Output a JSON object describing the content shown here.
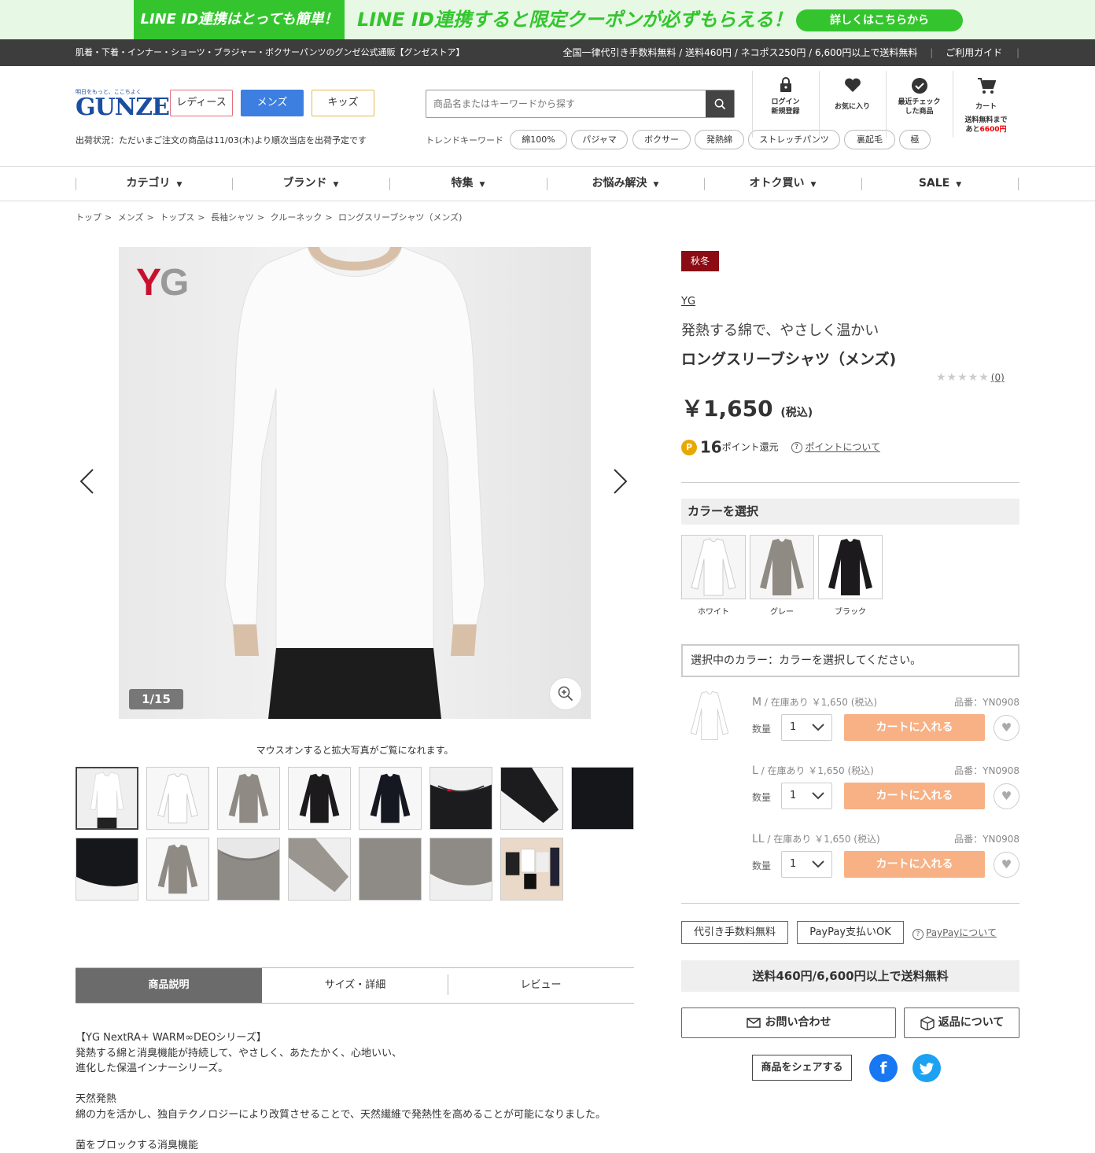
{
  "banner": {
    "left": "LINE ID連携はとっても簡単！",
    "middle": "LINE ID連携すると限定クーポンが必ずもらえる！",
    "button": "詳しくはこちらから"
  },
  "topbar": {
    "left": "肌着・下着・インナー・ショーツ・ブラジャー・ボクサーパンツのグンゼ公式通販【グンゼストア】",
    "shipping": "全国一律代引き手数料無料 / 送料460円 / ネコポス250円 / 6,600円以上で送料無料",
    "guide": "ご利用ガイド"
  },
  "logo": {
    "tagline": "明日をもっと、ここちよく",
    "word": "GUNZE"
  },
  "gender": [
    "レディース",
    "メンズ",
    "キッズ"
  ],
  "status": "出荷状況：ただいまご注文の商品は11/03(木)より順次当店を出荷予定です",
  "search": {
    "placeholder": "商品名またはキーワードから探す"
  },
  "trend": {
    "label": "トレンドキーワード",
    "chips": [
      "綿100%",
      "パジャマ",
      "ボクサー",
      "発熱綿",
      "ストレッチパンツ",
      "裏起毛",
      "極"
    ]
  },
  "header_icons": {
    "login": {
      "line1": "ログイン",
      "line2": "新規登録"
    },
    "fav": {
      "line1": "お気に入り"
    },
    "recent": {
      "line1": "最近チェック",
      "line2": "した商品"
    },
    "cart": {
      "line1": "カート",
      "line2": "送料無料まで",
      "line3a": "あと",
      "line3b": "6600円"
    }
  },
  "nav": [
    "カテゴリ",
    "ブランド",
    "特集",
    "お悩み解決",
    "オトク買い",
    "SALE"
  ],
  "breadcrumb": [
    "トップ",
    "メンズ",
    "トップス",
    "長袖シャツ",
    "クルーネック",
    "ロングスリーブシャツ（メンズ)"
  ],
  "gallery": {
    "logo_y": "Y",
    "logo_g": "G",
    "counter": "1/15",
    "note": "マウスオンすると拡大写真がご覧になれます。"
  },
  "tabs": [
    "商品説明",
    "サイズ・詳細",
    "レビュー"
  ],
  "description": [
    "【YG NextRA+ WARM∞DEOシリーズ】",
    "発熱する綿と消臭機能が持続して、やさしく、あたたかく、心地いい、",
    "進化した保温インナーシリーズ。",
    "",
    "天然発熱",
    "綿の力を活かし、独自テクノロジーにより改質させることで、天然繊維で発熱性を高めることが可能になりました。",
    "",
    "菌をブロックする消臭機能"
  ],
  "product": {
    "badge": "秋冬",
    "brand": "YG",
    "catch": "発熱する綿で、やさしく温かい",
    "title": "ロングスリーブシャツ（メンズ)",
    "stars": "★★★★★",
    "review_count": "(0)",
    "price": "￥1,650",
    "tax": "(税込)",
    "points_icon": "P",
    "points": "16",
    "points_unit": "ポイント還元",
    "points_link": "ポイントについて"
  },
  "color": {
    "heading": "カラーを選択",
    "options": [
      "ホワイト",
      "グレー",
      "ブラック"
    ],
    "selected_label": "選択中のカラー：カラーを選択してください。"
  },
  "sizes": [
    {
      "size": "M",
      "stock": " / 在庫あり ￥1,650 (税込)",
      "code": "品番：YN0908",
      "qty_label": "数量",
      "qty": "1",
      "cart": "カートに入れる"
    },
    {
      "size": "L",
      "stock": " / 在庫あり ￥1,650 (税込)",
      "code": "品番：YN0908",
      "qty_label": "数量",
      "qty": "1",
      "cart": "カートに入れる"
    },
    {
      "size": "LL",
      "stock": " / 在庫あり ￥1,650 (税込)",
      "code": "品番：YN0908",
      "qty_label": "数量",
      "qty": "1",
      "cart": "カートに入れる"
    }
  ],
  "options": {
    "cod": "代引き手数料無料",
    "paypay": "PayPay支払いOK",
    "paypay_link": "PayPayについて"
  },
  "shipping_bar": "送料460円/6,600円以上で送料無料",
  "buttons": {
    "contact": "お問い合わせ",
    "returns": "返品について",
    "share": "商品をシェアする"
  },
  "colors": {
    "brand_blue": "#3d7fe0",
    "line_green": "#34c52e",
    "cart_orange": "#f7b184",
    "badge_red": "#8b0c14"
  }
}
